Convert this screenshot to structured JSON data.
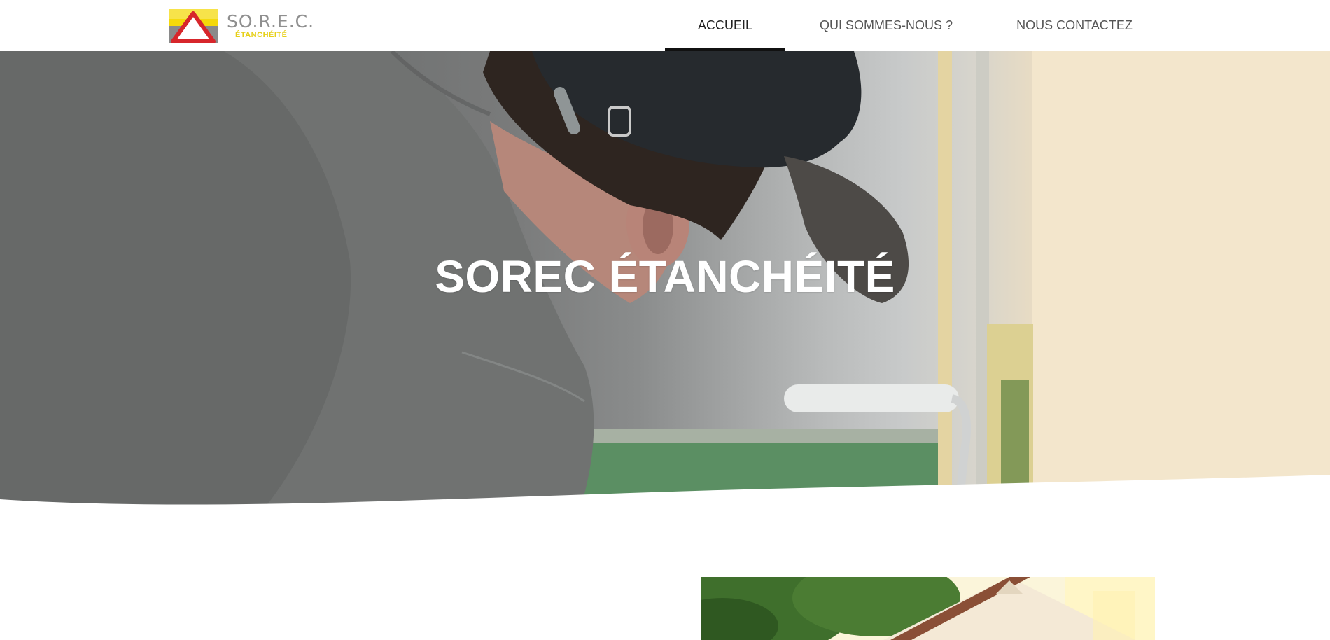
{
  "header": {
    "logo": {
      "name": "SO.R.E.C.",
      "sub": "ÉTANCHÉITÉ"
    },
    "nav": [
      {
        "label": "ACCUEIL",
        "active": true
      },
      {
        "label": "QUI SOMMES-NOUS ?",
        "active": false
      },
      {
        "label": "NOUS CONTACTEZ",
        "active": false
      }
    ]
  },
  "hero": {
    "title": "SOREC ÉTANCHÉITÉ"
  },
  "colors": {
    "brand_yellow": "#f5d90a",
    "brand_red": "#d7262b",
    "brand_grey": "#8f8f8f",
    "nav_active_underline": "#111111"
  },
  "icons": {
    "logo": "warning-triangle-logo"
  }
}
